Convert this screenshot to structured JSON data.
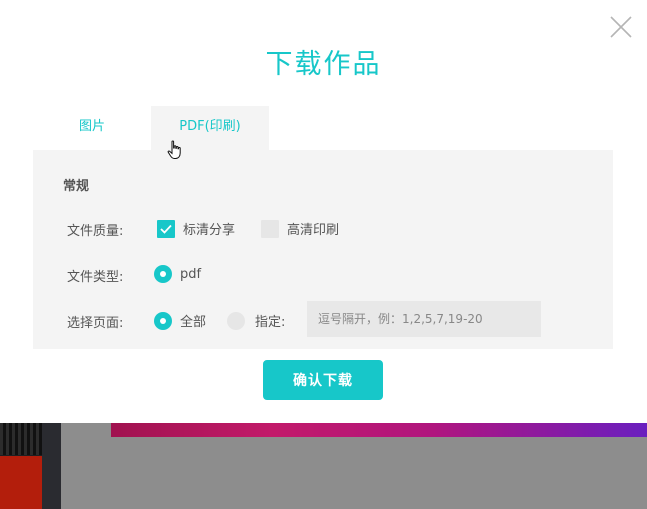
{
  "dialog": {
    "title": "下载作品",
    "close_icon": "close-icon"
  },
  "tabs": [
    {
      "label": "图片",
      "active": false
    },
    {
      "label": "PDF(印刷)",
      "active": true
    }
  ],
  "section": {
    "title": "常规",
    "quality": {
      "label": "文件质量:",
      "options": [
        {
          "label": "标清分享",
          "checked": true
        },
        {
          "label": "高清印刷",
          "checked": false
        }
      ]
    },
    "file_type": {
      "label": "文件类型:",
      "options": [
        {
          "label": "pdf",
          "selected": true
        }
      ]
    },
    "pages": {
      "label": "选择页面:",
      "options": [
        {
          "label": "全部",
          "selected": true
        },
        {
          "label": "指定:",
          "selected": false
        }
      ],
      "input_placeholder": "逗号隔开，例：1,2,5,7,19-20",
      "input_value": ""
    }
  },
  "confirm_label": "确认下载",
  "colors": {
    "accent": "#17c7c9",
    "panel_bg": "#f4f4f4",
    "text": "#555555"
  }
}
